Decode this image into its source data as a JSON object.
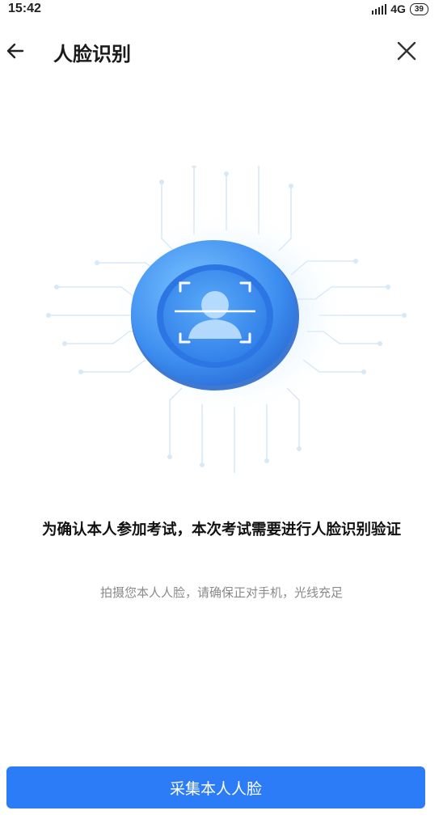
{
  "status": {
    "time": "15:42",
    "network": "4G",
    "battery": "39"
  },
  "nav": {
    "title": "人脸识别"
  },
  "headline": "为确认本人参加考试，本次考试需要进行人脸识别验证",
  "subline": "拍摄您本人人脸，请确保正对手机，光线充足",
  "button": {
    "label": "采集本人人脸"
  },
  "colors": {
    "primary": "#2b7cf6",
    "accent_light": "#8cc8ff"
  }
}
